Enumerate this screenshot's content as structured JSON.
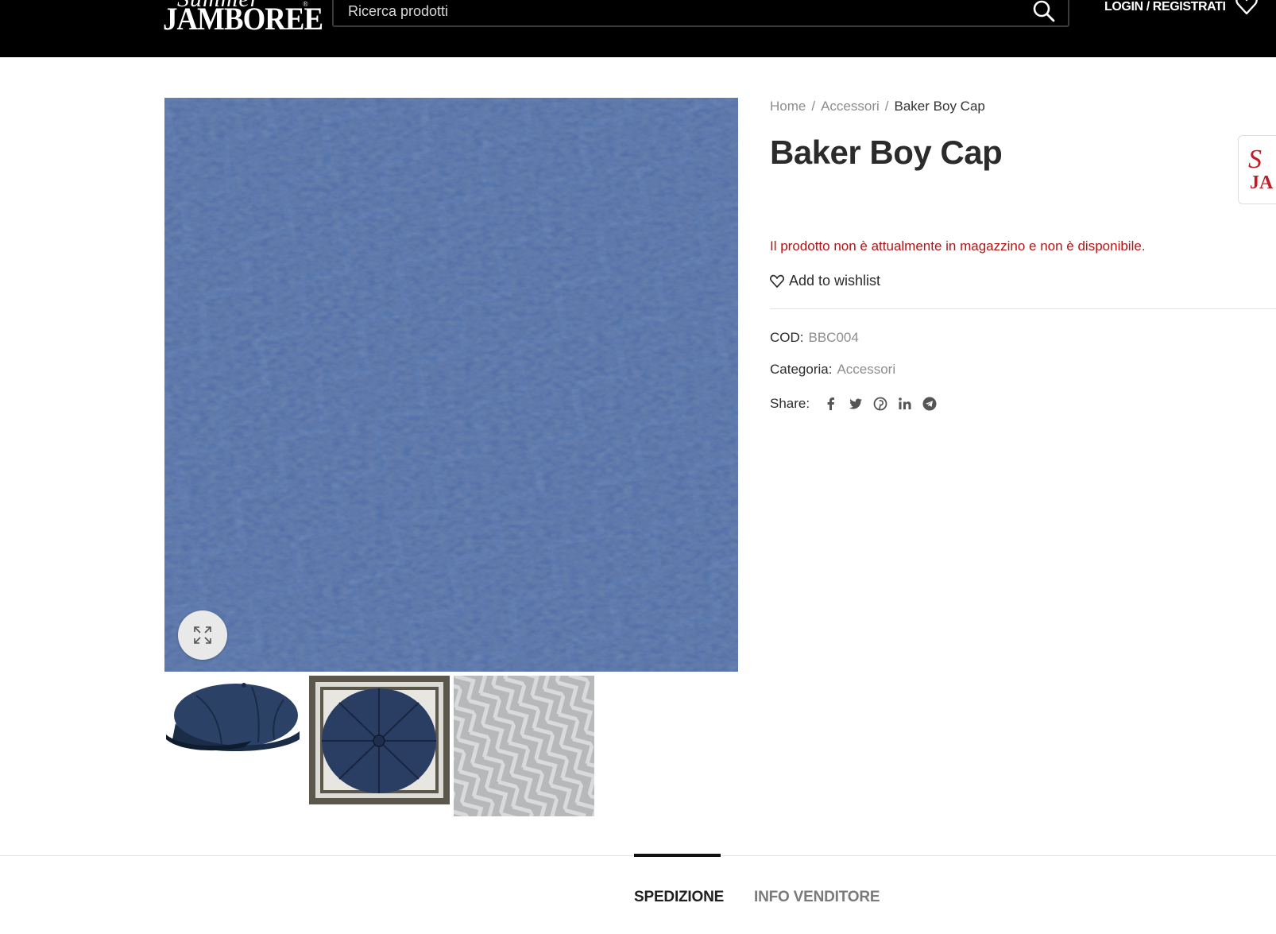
{
  "header": {
    "logo_script": "Summer",
    "logo_main": "JAMBOREE",
    "logo_reg": "®",
    "search_placeholder": "Ricerca prodotti",
    "login_label": "LOGIN / REGISTRATI",
    "search_icon": "search-icon",
    "wishlist_icon": "heart-icon"
  },
  "breadcrumb": {
    "items": [
      "Home",
      "Accessori"
    ],
    "separator": "/",
    "current": "Baker Boy Cap"
  },
  "product": {
    "title": "Baker Boy Cap",
    "stock_message": "Il prodotto non è attualmente in magazzino e non è disponibile.",
    "wishlist_label": "Add to wishlist",
    "cod_label": "COD:",
    "cod_value": "BBC004",
    "category_label": "Categoria:",
    "category_value": "Accessori",
    "share_label": "Share:",
    "share_icons": [
      "facebook-icon",
      "twitter-icon",
      "pinterest-icon",
      "linkedin-icon",
      "telegram-icon"
    ]
  },
  "gallery": {
    "main_image": "blue herringbone tweed fabric",
    "thumbnails": [
      "baker boy cap side view",
      "baker boy cap top view",
      "light grey herringbone fabric"
    ]
  },
  "tabs": {
    "items": [
      "SPEDIZIONE",
      "INFO VENDITORE"
    ],
    "active": "SPEDIZIONE"
  },
  "colors": {
    "header_bg": "#000000",
    "stock_text": "#b11414",
    "muted_text": "#8d8d8d"
  }
}
